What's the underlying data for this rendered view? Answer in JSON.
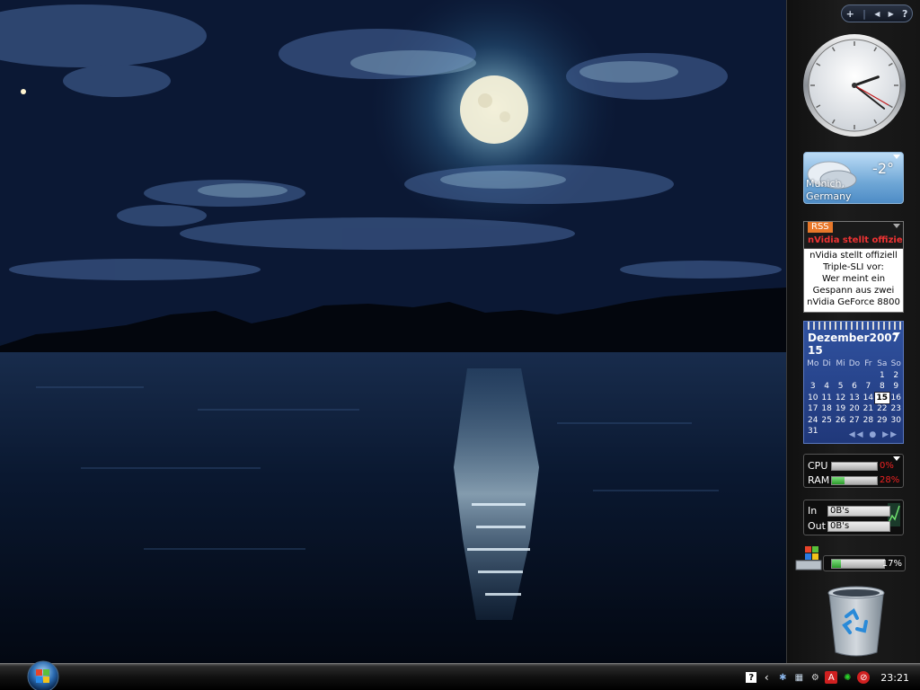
{
  "sidebar": {
    "controls": {
      "add": "+",
      "separator": "|",
      "prev": "◀",
      "next": "▶",
      "help": "?"
    }
  },
  "clock_gadget": {
    "hours": 2,
    "minutes": 21,
    "seconds": 20
  },
  "weather": {
    "temperature": "-2°",
    "location_line1": "Munich,",
    "location_line2": "Germany",
    "icon": "cloudy-icon"
  },
  "rss": {
    "badge": "RSS",
    "headline": "nVidia stellt offiziell",
    "body_lines": [
      "nVidia stellt offiziell",
      "Triple-SLI vor:",
      "Wer meint ein",
      "Gespann aus zwei",
      "nVidia GeForce 8800"
    ]
  },
  "calendar": {
    "month": "Dezember 15",
    "year": "2007",
    "weekdays": [
      "Mo",
      "Di",
      "Mi",
      "Do",
      "Fr",
      "Sa",
      "So"
    ],
    "weeks": [
      [
        "",
        "",
        "",
        "",
        "",
        "1",
        "2"
      ],
      [
        "3",
        "4",
        "5",
        "6",
        "7",
        "8",
        "9"
      ],
      [
        "10",
        "11",
        "12",
        "13",
        "14",
        "15",
        "16"
      ],
      [
        "17",
        "18",
        "19",
        "20",
        "21",
        "22",
        "23"
      ],
      [
        "24",
        "25",
        "26",
        "27",
        "28",
        "29",
        "30"
      ],
      [
        "31",
        "",
        "",
        "",
        "",
        "",
        ""
      ]
    ],
    "today": "15",
    "nav_labels": [
      "◀◀",
      "●",
      "▶▶"
    ]
  },
  "cpu_meter": {
    "cpu_label": "CPU",
    "cpu_value": "0%",
    "cpu_fraction": 0.0,
    "ram_label": "RAM",
    "ram_value": "28%",
    "ram_fraction": 0.28
  },
  "net_meter": {
    "in_label": "In",
    "in_value": "0B's",
    "out_label": "Out",
    "out_value": "0B's"
  },
  "disk_meter": {
    "value": "17%",
    "fraction": 0.17
  },
  "taskbar": {
    "clock": "23:21",
    "tray_icons": [
      "help-icon",
      "chevron-left-icon",
      "settings-icon",
      "network-icon",
      "steam-icon",
      "antivirus-icon",
      "sync-icon",
      "stop-icon"
    ]
  },
  "colors": {
    "accent": "#e8782a",
    "calendar_bg": "#2a4890",
    "meter_red": "#e22222",
    "meter_green": "#2a9a2a"
  }
}
